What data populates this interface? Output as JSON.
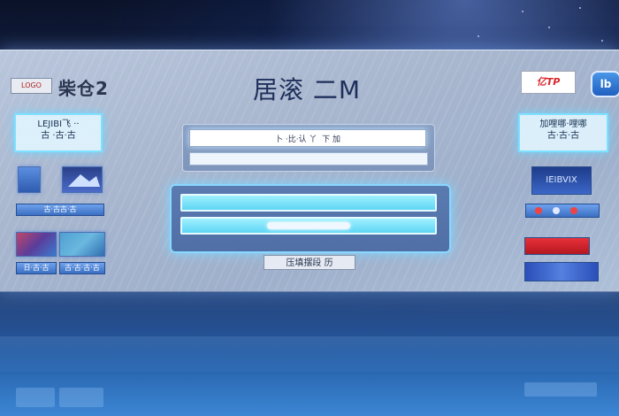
{
  "header": {
    "logo_box_text": "LOGO",
    "logo_text": "柴仓2",
    "title": "居滚 二M",
    "brand_badge": "亿TP",
    "corner_button": "lb"
  },
  "left_panel": {
    "top_label_line1": "LEJIBI飞 ··",
    "top_label_line2": "古 ·古·古",
    "chips": [
      "古·古古·古",
      "日·古·古",
      "古·古·古·古"
    ]
  },
  "center": {
    "search_value": "卜 ·比·认 丫  下 加",
    "action_button": "压填摆段 历"
  },
  "right_panel": {
    "top_label_line1": "加哩哪·哩哪",
    "top_label_line2": "古·古·古",
    "banner_text": "IEIBVIX"
  },
  "colors": {
    "accent_glow": "#7fe0ff",
    "panel_bg": "#aab9d2",
    "title_color": "#1e2f5a",
    "brand_red": "#d8262b"
  }
}
